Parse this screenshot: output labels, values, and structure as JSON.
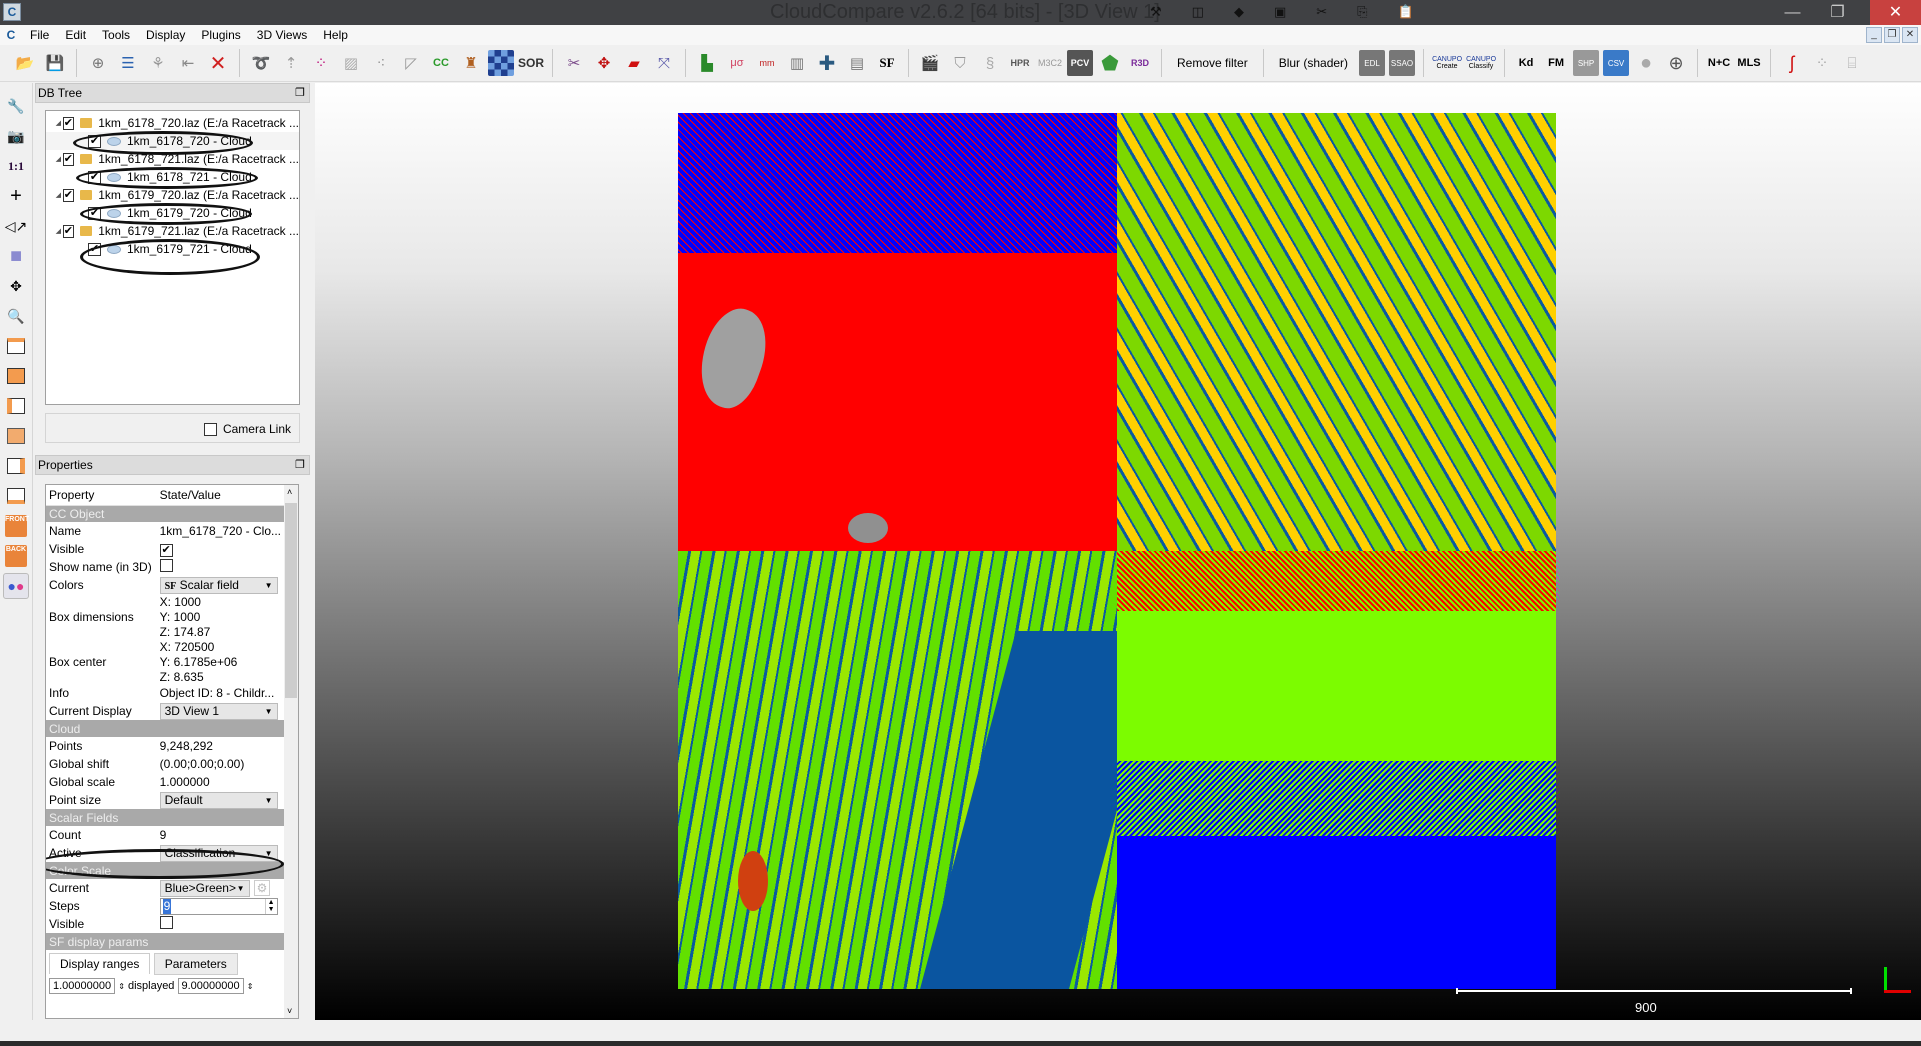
{
  "window": {
    "title": "CloudCompare v2.6.2 [64 bits] - [3D View 1]",
    "app_icon": "cloudcompare-logo-icon",
    "controls": [
      "minimize",
      "restore",
      "close"
    ]
  },
  "menubar": {
    "items": [
      "File",
      "Edit",
      "Tools",
      "Display",
      "Plugins",
      "3D Views",
      "Help"
    ]
  },
  "toolbar": {
    "icons": [
      "open-folder",
      "save",
      "clone",
      "list",
      "sample",
      "merge",
      "delete",
      "register",
      "normal",
      "subsample",
      "mesh",
      "scatter",
      "dist",
      "cc",
      "bottle",
      "checkerboard",
      "sor",
      "scissors",
      "translate",
      "section",
      "crosshair",
      "histogram",
      "statistics",
      "min-max",
      "palette",
      "add",
      "calculator",
      "sf",
      "film",
      "shield",
      "ribbon",
      "hpr",
      "m3c2",
      "pcv",
      "dodecahedron",
      "r3d"
    ],
    "remove_filter_label": "Remove filter",
    "blur_shader_label": "Blur (shader)",
    "shader_icons": [
      "EDL",
      "SSAO"
    ],
    "canupo": [
      {
        "top": "CANUPO",
        "bottom": "Create"
      },
      {
        "top": "CANUPO",
        "bottom": "Classify"
      }
    ],
    "right_icons": [
      "Kd",
      "FM",
      "SHP",
      "CSV",
      "sphere",
      "globe",
      "N+C",
      "MLS",
      "s-curve",
      "scatter-gray",
      "cylinder"
    ]
  },
  "left_toolbar": {
    "items": [
      "wrench",
      "camera",
      "1:1",
      "crosshair",
      "rotate",
      "cube-view",
      "move",
      "zoom",
      "top-view",
      "front-view",
      "left-view",
      "back-view",
      "right-view",
      "bottom-view",
      "FRONT",
      "BACK",
      "stereo"
    ]
  },
  "db_tree": {
    "title": "DB Tree",
    "entries": [
      {
        "file": "1km_6178_720.laz (E:/a Racetrack ...",
        "cloud": "1km_6178_720 - Cloud",
        "checked": true
      },
      {
        "file": "1km_6178_721.laz (E:/a Racetrack ...",
        "cloud": "1km_6178_721 - Cloud",
        "checked": true
      },
      {
        "file": "1km_6179_720.laz (E:/a Racetrack ...",
        "cloud": "1km_6179_720 - Cloud",
        "checked": true
      },
      {
        "file": "1km_6179_721.laz (E:/a Racetrack ...",
        "cloud": "1km_6179_721 - Cloud",
        "checked": true
      }
    ],
    "camera_link_label": "Camera Link",
    "camera_link_checked": false
  },
  "properties": {
    "title": "Properties",
    "col_property": "Property",
    "col_value": "State/Value",
    "sec_cc_object": "CC Object",
    "name_label": "Name",
    "name_value": "1km_6178_720 - Clo...",
    "visible_label": "Visible",
    "show_name_label": "Show name (in 3D)",
    "colors_label": "Colors",
    "colors_value": "Scalar field",
    "box_dim_label": "Box dimensions",
    "box_dim_x": "X: 1000",
    "box_dim_y": "Y: 1000",
    "box_dim_z": "Z: 174.87",
    "box_center_label": "Box center",
    "box_center_x": "X: 720500",
    "box_center_y": "Y: 6.1785e+06",
    "box_center_z": "Z: 8.635",
    "info_label": "Info",
    "info_value": "Object ID: 8 - Childr...",
    "current_display_label": "Current Display",
    "current_display_value": "3D View 1",
    "sec_cloud": "Cloud",
    "points_label": "Points",
    "points_value": "9,248,292",
    "global_shift_label": "Global shift",
    "global_shift_value": "(0.00;0.00;0.00)",
    "global_scale_label": "Global scale",
    "global_scale_value": "1.000000",
    "point_size_label": "Point size",
    "point_size_value": "Default",
    "sec_scalar": "Scalar Fields",
    "count_label": "Count",
    "count_value": "9",
    "active_label": "Active",
    "active_value": "Classification",
    "sec_color_scale": "Color Scale",
    "current_label": "Current",
    "current_value": "Blue>Green>",
    "steps_label": "Steps",
    "steps_value": "9",
    "cs_visible_label": "Visible",
    "sec_sf_display": "SF display params",
    "tab_display_ranges": "Display ranges",
    "tab_parameters": "Parameters",
    "range_min": "1.00000000",
    "displayed_label": "displayed",
    "range_max": "9.00000000"
  },
  "view3d": {
    "scale_label": "900",
    "colors": {
      "ground": "#ff0000",
      "water": "#0000ff",
      "veg": "#7cfc00",
      "building": "#ffd000",
      "road": "#0a5aa0",
      "unclassified": "#a0a0a0"
    }
  }
}
